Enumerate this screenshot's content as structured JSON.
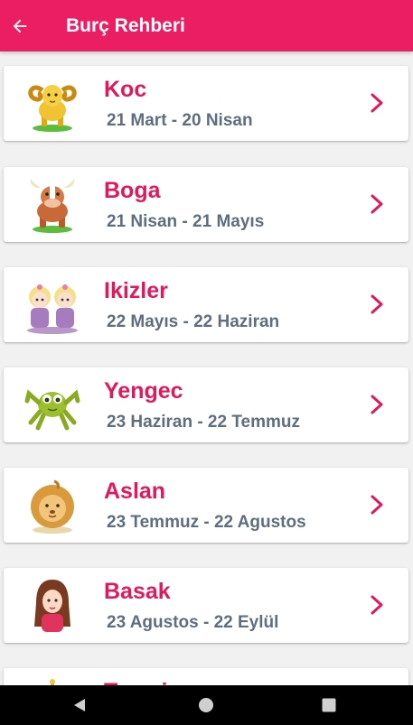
{
  "app_bar": {
    "title": "Burç Rehberi",
    "back_icon": "arrow-left-icon",
    "color": "#ec1e63"
  },
  "signs": [
    {
      "name": "Koc",
      "dates": "21 Mart - 20 Nisan",
      "icon": "ram-icon"
    },
    {
      "name": "Boga",
      "dates": "21 Nisan - 21 Mayıs",
      "icon": "bull-icon"
    },
    {
      "name": "Ikizler",
      "dates": "22 Mayıs - 22 Haziran",
      "icon": "twins-icon"
    },
    {
      "name": "Yengec",
      "dates": "23 Haziran - 22 Temmuz",
      "icon": "crab-icon"
    },
    {
      "name": "Aslan",
      "dates": "23 Temmuz - 22 Agustos",
      "icon": "lion-icon"
    },
    {
      "name": "Basak",
      "dates": "23 Agustos - 22 Eylül",
      "icon": "maiden-icon"
    },
    {
      "name": "Terazi",
      "dates": "",
      "icon": "scales-icon"
    }
  ],
  "colors": {
    "sign_name": "#e0195d",
    "sign_dates": "#5d6e80",
    "chevron": "#e0195d",
    "background": "#f1f1f1"
  },
  "system_nav": {
    "back": "nav-back-icon",
    "home": "nav-home-icon",
    "recents": "nav-recents-icon"
  }
}
